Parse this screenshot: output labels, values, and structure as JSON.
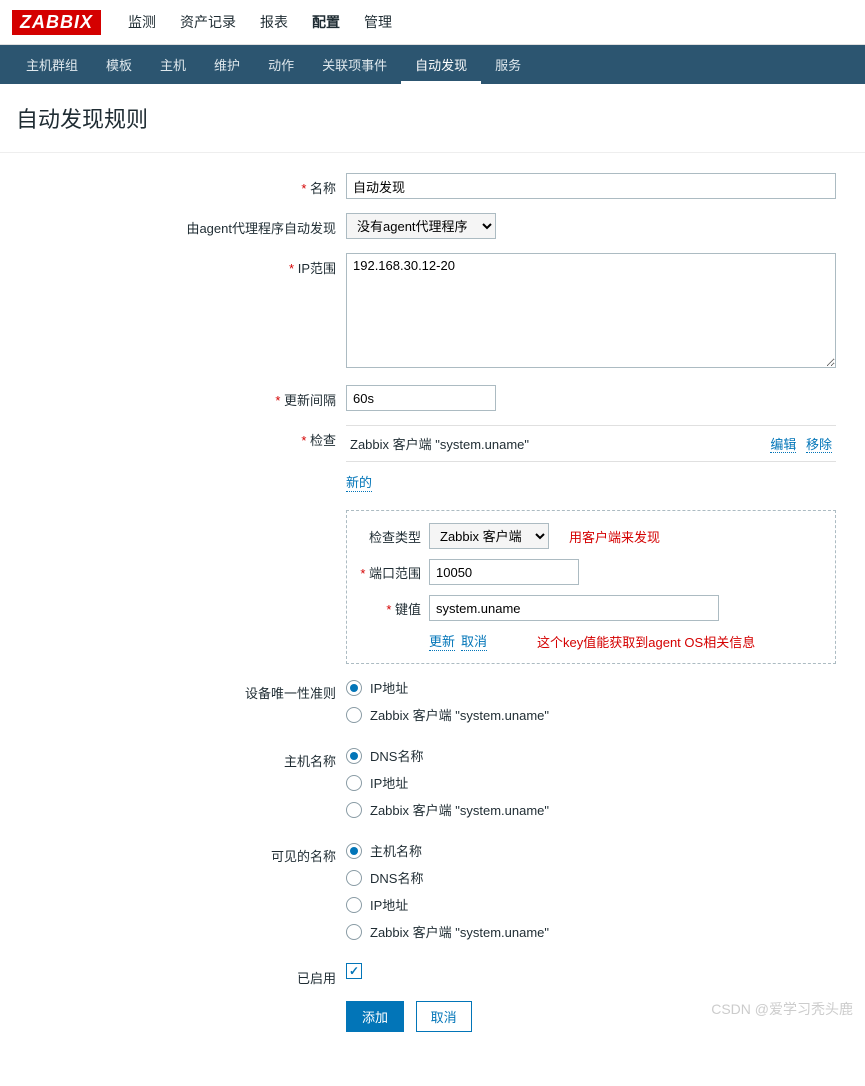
{
  "logo": "ZABBIX",
  "topnav": [
    "监测",
    "资产记录",
    "报表",
    "配置",
    "管理"
  ],
  "topnav_active": 3,
  "subnav": [
    "主机群组",
    "模板",
    "主机",
    "维护",
    "动作",
    "关联项事件",
    "自动发现",
    "服务"
  ],
  "subnav_active": 6,
  "page_title": "自动发现规则",
  "labels": {
    "name": "名称",
    "proxy": "由agent代理程序自动发现",
    "ip_range": "IP范围",
    "interval": "更新间隔",
    "checks": "检查",
    "check_type": "检查类型",
    "port_range": "端口范围",
    "key": "键值",
    "uniqueness": "设备唯一性准则",
    "host_name": "主机名称",
    "visible_name": "可见的名称",
    "enabled": "已启用"
  },
  "values": {
    "name": "自动发现",
    "proxy": "没有agent代理程序",
    "ip_range": "192.168.30.12-20",
    "interval": "60s",
    "check_item": "Zabbix 客户端 \"system.uname\"",
    "check_type": "Zabbix 客户端",
    "port_range": "10050",
    "key": "system.uname"
  },
  "links": {
    "edit": "编辑",
    "remove": "移除",
    "new": "新的",
    "update": "更新",
    "cancel": "取消"
  },
  "notes": {
    "check_type_note": "用客户端来发现",
    "key_note": "这个key值能获取到agent OS相关信息"
  },
  "radios": {
    "uniqueness": [
      {
        "label": "IP地址",
        "checked": true
      },
      {
        "label": "Zabbix 客户端 \"system.uname\"",
        "checked": false
      }
    ],
    "host_name": [
      {
        "label": "DNS名称",
        "checked": true
      },
      {
        "label": "IP地址",
        "checked": false
      },
      {
        "label": "Zabbix 客户端 \"system.uname\"",
        "checked": false
      }
    ],
    "visible_name": [
      {
        "label": "主机名称",
        "checked": true
      },
      {
        "label": "DNS名称",
        "checked": false
      },
      {
        "label": "IP地址",
        "checked": false
      },
      {
        "label": "Zabbix 客户端 \"system.uname\"",
        "checked": false
      }
    ]
  },
  "buttons": {
    "add": "添加",
    "cancel": "取消"
  },
  "watermark": "CSDN @爱学习秃头鹿"
}
